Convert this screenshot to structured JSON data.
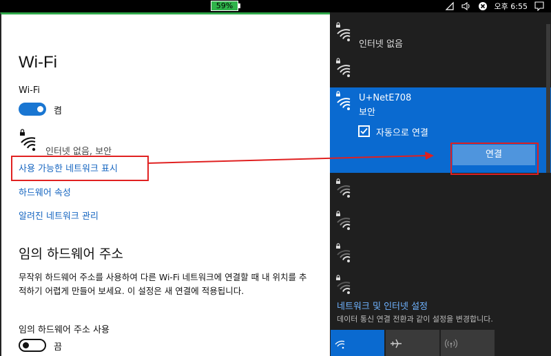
{
  "taskbar": {
    "battery": "59%",
    "time": "오후 6:55"
  },
  "settings": {
    "title": "Wi-Fi",
    "wifi_label": "Wi-Fi",
    "wifi_state": "켬",
    "current_network_status": "인터넷 없음, 보안",
    "show_networks": "사용 가능한 네트워크 표시",
    "hardware_props": "하드웨어 속성",
    "known_networks": "알려진 네트워크 관리",
    "random_hw_title": "임의 하드웨어 주소",
    "random_hw_desc": "무작위 하드웨어 주소를 사용하여 다른 Wi-Fi 네트워크에 연결할 때 내 위치를 추적하기 어렵게 만들어 보세요. 이 설정은 새 연결에 적용됩니다.",
    "random_hw_use": "임의 하드웨어 주소 사용",
    "random_hw_state": "끔"
  },
  "flyout": {
    "networks": [
      {
        "status": "인터넷 없음"
      },
      {
        "status": ""
      },
      {
        "name": "U+NetE708",
        "status": "보안",
        "auto_connect": "자동으로 연결",
        "connect": "연결"
      }
    ],
    "settings_link": "네트워크 및 인터넷 설정",
    "settings_sub": "데이터 통신 연결 전환과 같이 설정을 변경합니다."
  },
  "colors": {
    "accent": "#0a6ad0",
    "highlight": "#e02020",
    "link": "#1565c0"
  }
}
